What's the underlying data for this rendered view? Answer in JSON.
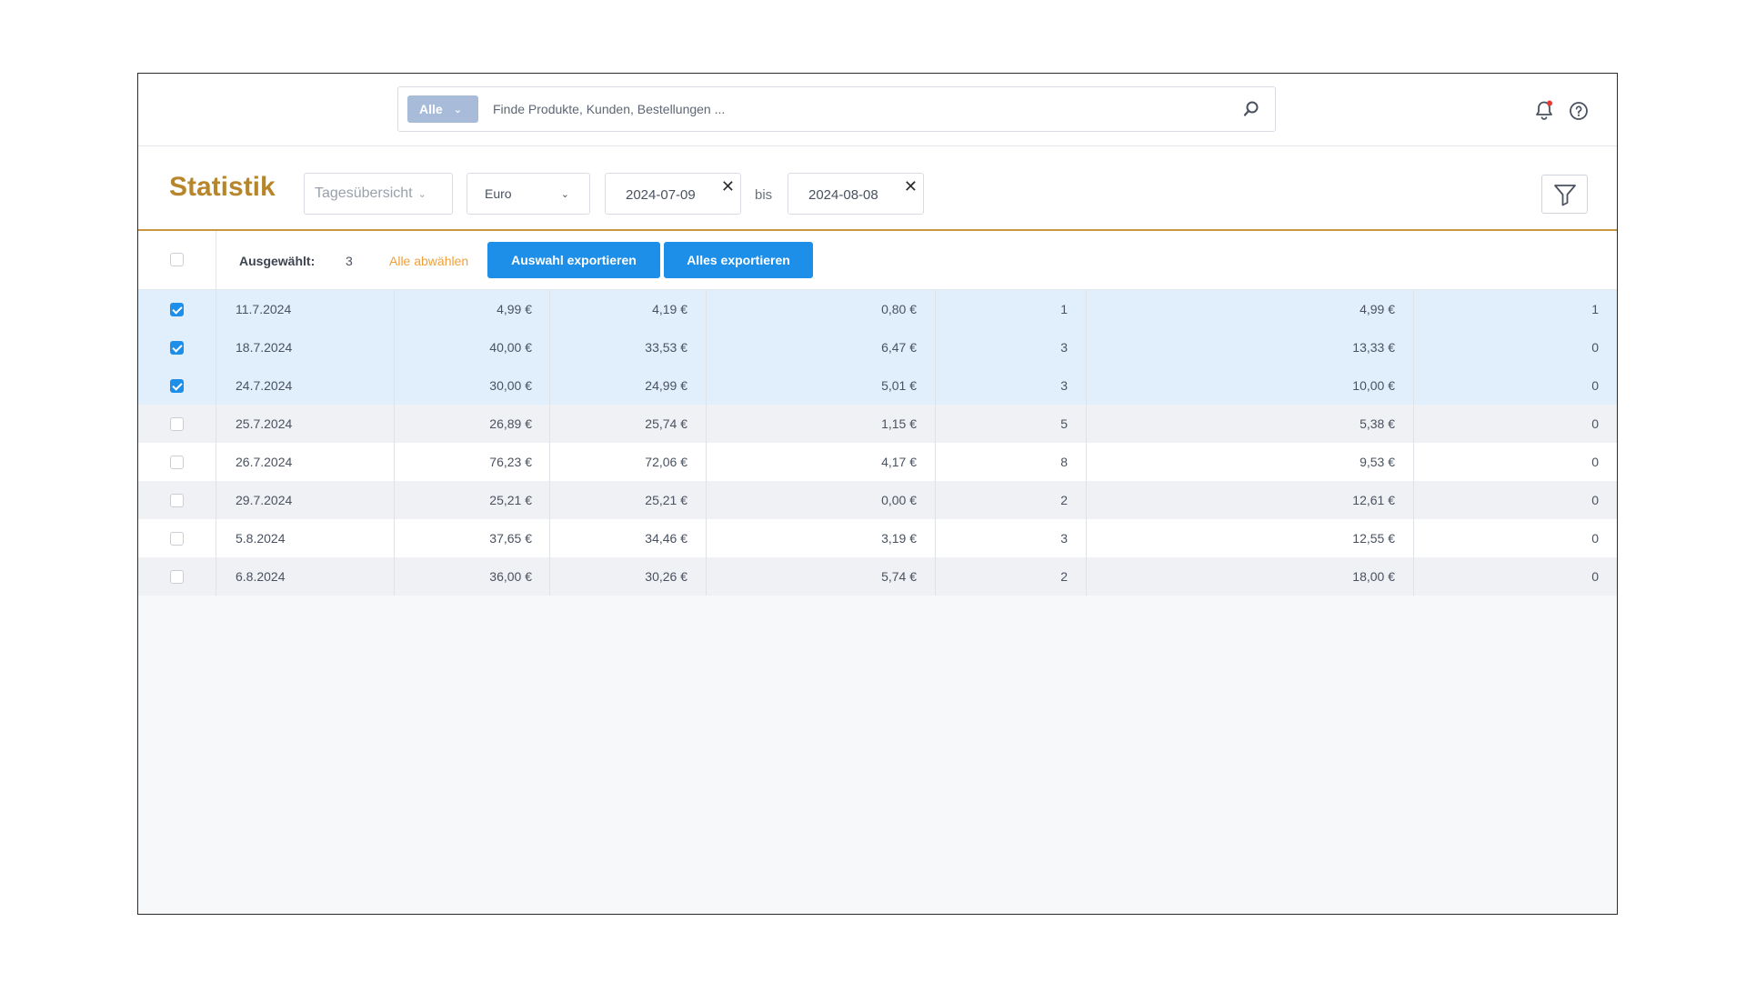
{
  "search": {
    "scope": "Alle",
    "placeholder": "Finde Produkte, Kunden, Bestellungen ..."
  },
  "page": {
    "title": "Statistik"
  },
  "filters": {
    "view": "Tagesübersicht",
    "currency": "Euro",
    "date_from": "2024-07-09",
    "date_separator": "bis",
    "date_to": "2024-08-08"
  },
  "selection": {
    "label": "Ausgewählt:",
    "count": "3",
    "deselect_all": "Alle abwählen",
    "export_selected": "Auswahl exportieren",
    "export_all": "Alles exportieren"
  },
  "rows": [
    {
      "selected": true,
      "cells": [
        "11.7.2024",
        "4,99 €",
        "4,19 €",
        "0,80 €",
        "1",
        "4,99 €",
        "1"
      ]
    },
    {
      "selected": true,
      "cells": [
        "18.7.2024",
        "40,00 €",
        "33,53 €",
        "6,47 €",
        "3",
        "13,33 €",
        "0"
      ]
    },
    {
      "selected": true,
      "cells": [
        "24.7.2024",
        "30,00 €",
        "24,99 €",
        "5,01 €",
        "3",
        "10,00 €",
        "0"
      ]
    },
    {
      "selected": false,
      "cells": [
        "25.7.2024",
        "26,89 €",
        "25,74 €",
        "1,15 €",
        "5",
        "5,38 €",
        "0"
      ]
    },
    {
      "selected": false,
      "cells": [
        "26.7.2024",
        "76,23 €",
        "72,06 €",
        "4,17 €",
        "8",
        "9,53 €",
        "0"
      ]
    },
    {
      "selected": false,
      "cells": [
        "29.7.2024",
        "25,21 €",
        "25,21 €",
        "0,00 €",
        "2",
        "12,61 €",
        "0"
      ]
    },
    {
      "selected": false,
      "cells": [
        "5.8.2024",
        "37,65 €",
        "34,46 €",
        "3,19 €",
        "3",
        "12,55 €",
        "0"
      ]
    },
    {
      "selected": false,
      "cells": [
        "6.8.2024",
        "36,00 €",
        "30,26 €",
        "5,74 €",
        "2",
        "18,00 €",
        "0"
      ]
    }
  ],
  "icons": {
    "search": "magnifier-icon",
    "notifications": "bell-icon",
    "help": "question-circle-icon",
    "filter": "funnel-icon",
    "clear": "close-icon",
    "dropdown": "chevron-down-icon"
  },
  "colors": {
    "accent": "#1e8fe9",
    "title": "#b7862a",
    "divider": "#c99642",
    "deselect": "#f0a03a",
    "selected_row": "#e1effc",
    "notification_dot": "#e53935"
  }
}
